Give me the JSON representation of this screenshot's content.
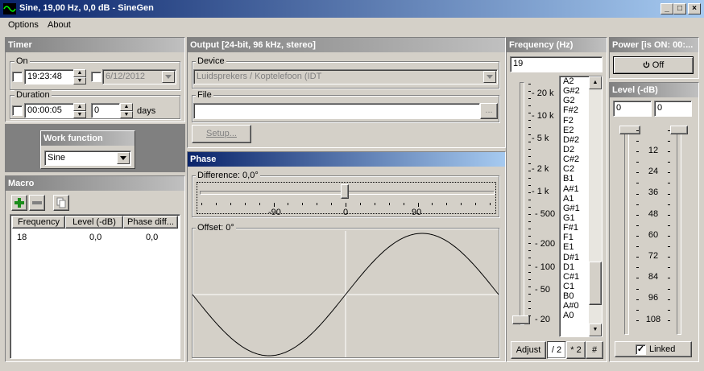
{
  "window": {
    "title": "Sine, 19,00 Hz, 0,0 dB - SineGen"
  },
  "menu": [
    "Options",
    "About"
  ],
  "timer": {
    "header": "Timer",
    "on_label": "On",
    "on_time": "19:23:48",
    "on_date": "6/12/2012",
    "duration_label": "Duration",
    "duration_time": "00:00:05",
    "duration_days": "0",
    "days_label": "days"
  },
  "work_function": {
    "header": "Work function",
    "value": "Sine"
  },
  "macro": {
    "header": "Macro",
    "columns": [
      "Frequency",
      "Level (-dB)",
      "Phase diff..."
    ],
    "rows": [
      [
        "18",
        "0,0",
        "0,0"
      ]
    ]
  },
  "output": {
    "header": "Output [24-bit, 96 kHz, stereo]",
    "device_label": "Device",
    "device_value": "Luidsprekers / Koptelefoon (IDT",
    "file_label": "File",
    "file_value": "",
    "browse_label": "...",
    "setup_label": "Setup..."
  },
  "phase": {
    "header": "Phase",
    "difference_label": "Difference: 0,0°",
    "ticks": [
      "-90",
      "0",
      "90"
    ],
    "offset_label": "Offset: 0°"
  },
  "frequency": {
    "header": "Frequency (Hz)",
    "value": "19",
    "scale": [
      "20 k",
      "10 k",
      "5 k",
      "2 k",
      "1 k",
      "500",
      "200",
      "100",
      "50",
      "20"
    ],
    "notes": [
      "A2",
      "G#2",
      "G2",
      "F#2",
      "F2",
      "E2",
      "D#2",
      "D2",
      "C#2",
      "C2",
      "B1",
      "A#1",
      "A1",
      "G#1",
      "G1",
      "F#1",
      "F1",
      "E1",
      "D#1",
      "D1",
      "C#1",
      "C1",
      "B0",
      "A#0",
      "A0"
    ],
    "buttons": [
      "Adjust",
      "/ 2",
      "* 2",
      "#"
    ]
  },
  "power": {
    "header": "Power [is ON: 00:...",
    "button": "Off"
  },
  "level": {
    "header": "Level (-dB)",
    "left": "0",
    "right": "0",
    "scale": [
      "12",
      "24",
      "36",
      "48",
      "60",
      "72",
      "84",
      "96",
      "108"
    ],
    "linked_label": "Linked"
  }
}
